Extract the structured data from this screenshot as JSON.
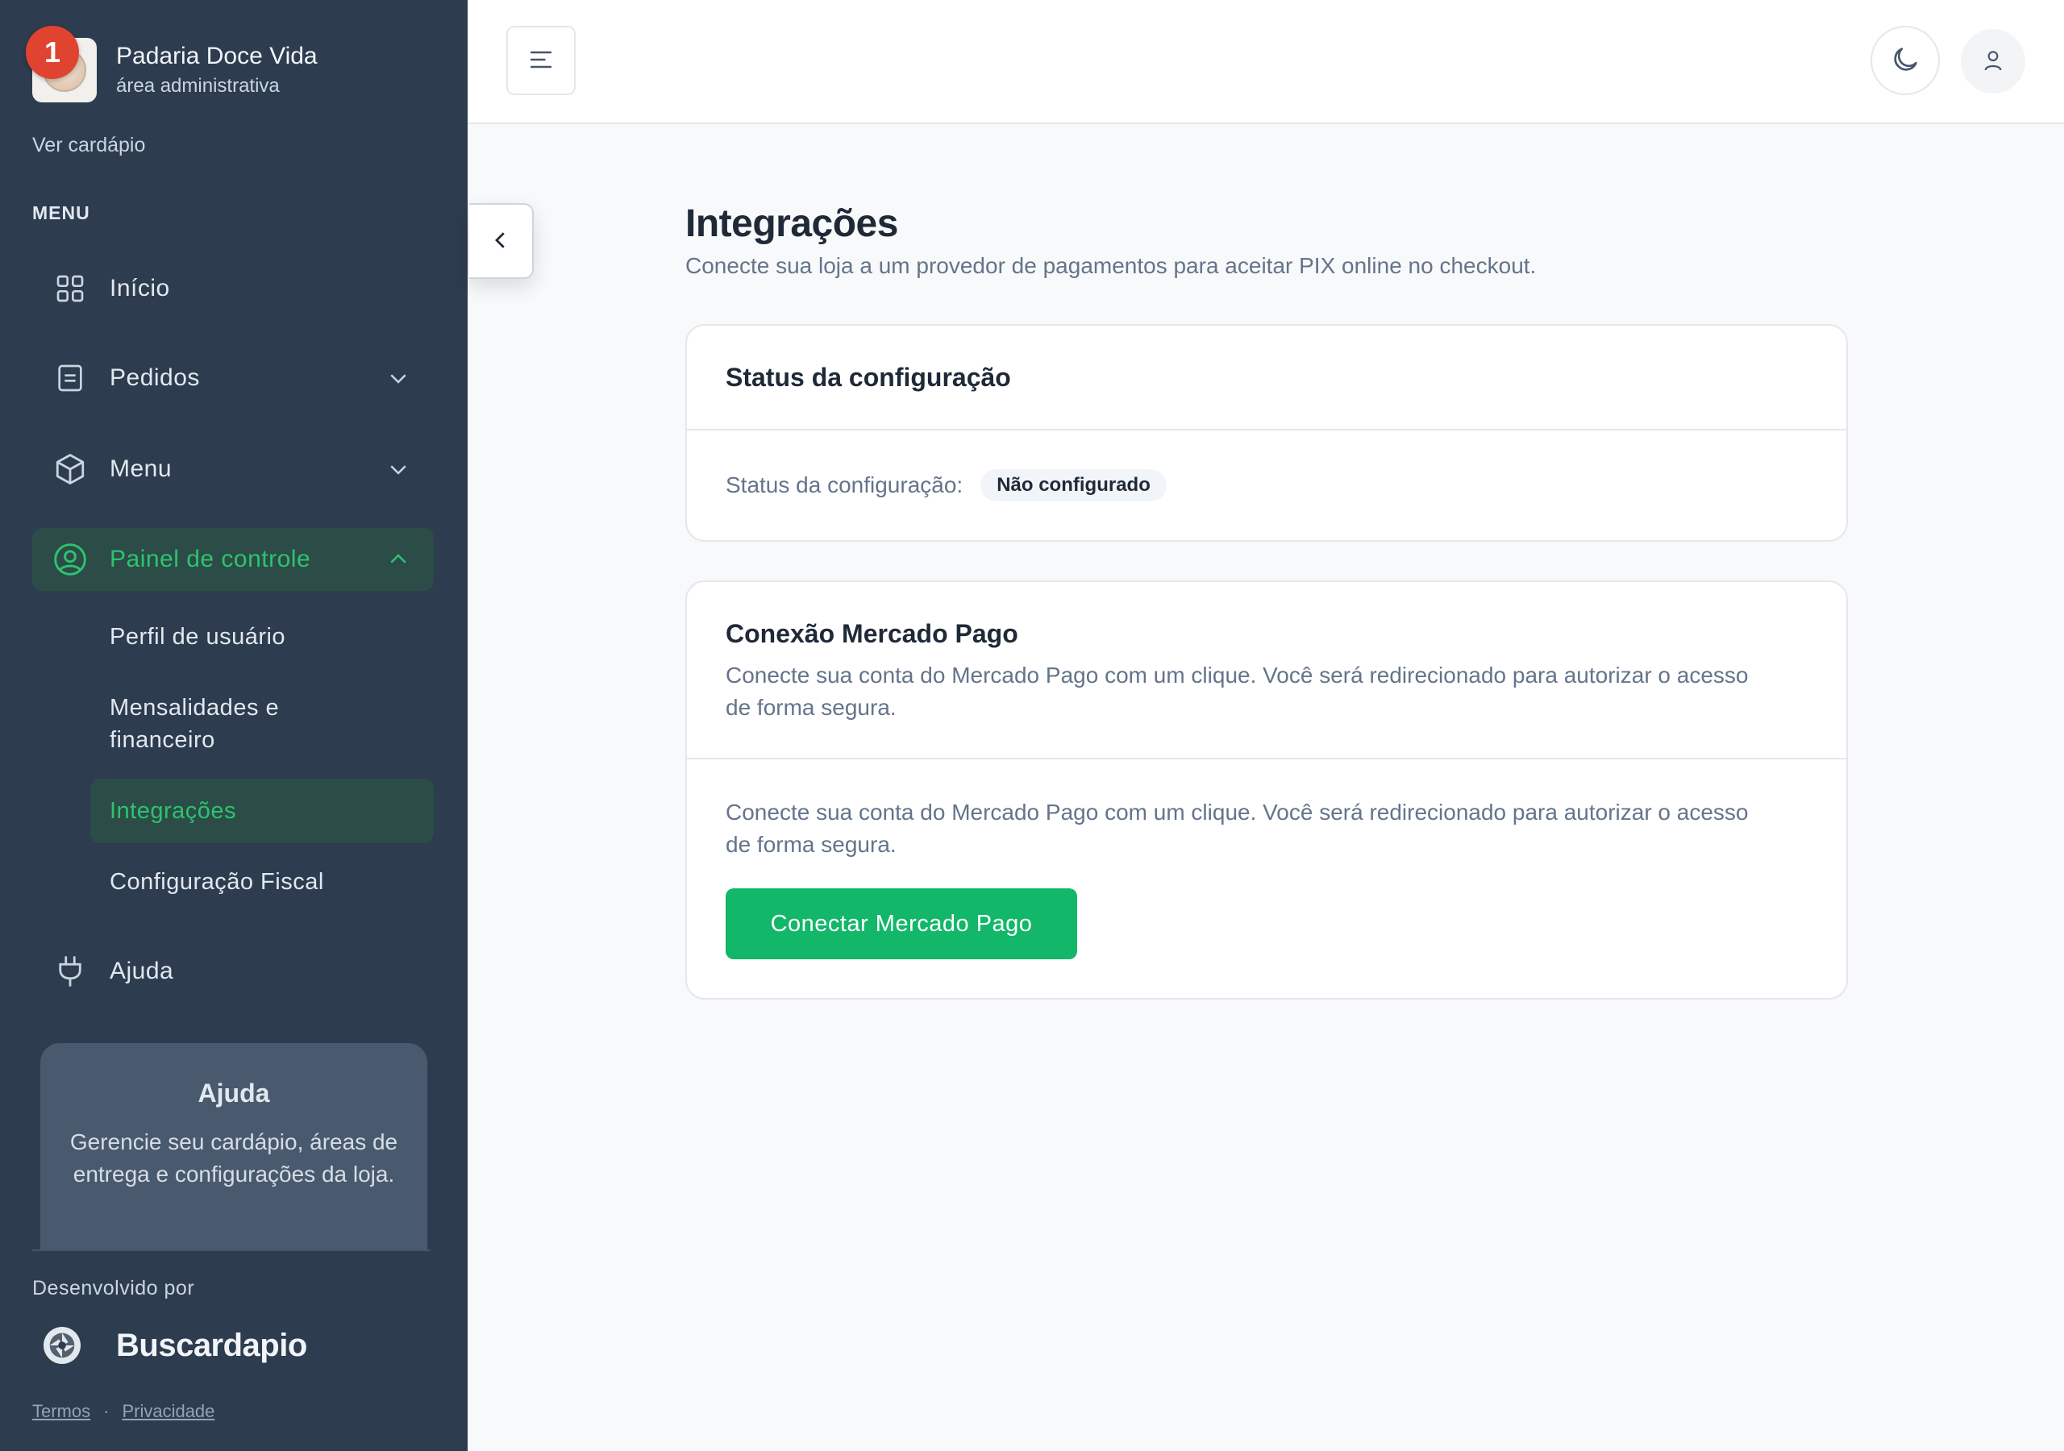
{
  "brand": {
    "name": "Padaria Doce Vida",
    "subtitle": "área administrativa",
    "notification_count": "1"
  },
  "sidebar": {
    "view_menu_link": "Ver cardápio",
    "section_heading": "MENU",
    "items": [
      {
        "label": "Início",
        "icon": "grid-icon"
      },
      {
        "label": "Pedidos",
        "icon": "document-icon",
        "expandable": true
      },
      {
        "label": "Menu",
        "icon": "box-icon",
        "expandable": true
      },
      {
        "label": "Painel de controle",
        "icon": "user-circle-icon",
        "expandable": true,
        "expanded": true,
        "active": true
      },
      {
        "label": "Ajuda",
        "icon": "plug-icon"
      }
    ],
    "subitems": [
      {
        "label": "Perfil de usuário"
      },
      {
        "label": "Mensalidades e financeiro"
      },
      {
        "label": "Integrações",
        "active": true
      },
      {
        "label": "Configuração Fiscal"
      }
    ],
    "help_card": {
      "title": "Ajuda",
      "text": "Gerencie seu cardápio, áreas de entrega e configurações da loja."
    },
    "developed_by_label": "Desenvolvido por",
    "developer_name": "Buscardapio",
    "legal": {
      "terms": "Termos",
      "separator": "·",
      "privacy": "Privacidade"
    }
  },
  "topbar": {
    "menu_toggle_icon": "menu-icon",
    "theme_toggle_icon": "moon-icon",
    "user_icon": "user-icon"
  },
  "main": {
    "title": "Integrações",
    "subtitle": "Conecte sua loja a um provedor de pagamentos para aceitar PIX online no checkout.",
    "status_card": {
      "title": "Status da configuração",
      "label": "Status da configuração:",
      "badge": "Não configurado"
    },
    "mercadopago_card": {
      "title": "Conexão Mercado Pago",
      "header_description": "Conecte sua conta do Mercado Pago com um clique. Você será redirecionado para autorizar o acesso de forma segura.",
      "body_description": "Conecte sua conta do Mercado Pago com um clique. Você será redirecionado para autorizar o acesso de forma segura.",
      "button_label": "Conectar Mercado Pago"
    }
  },
  "colors": {
    "sidebar_bg": "#2d3c4e",
    "accent_green": "#12b76a",
    "active_text": "#2dc36f",
    "notification_red": "#e0432f"
  }
}
